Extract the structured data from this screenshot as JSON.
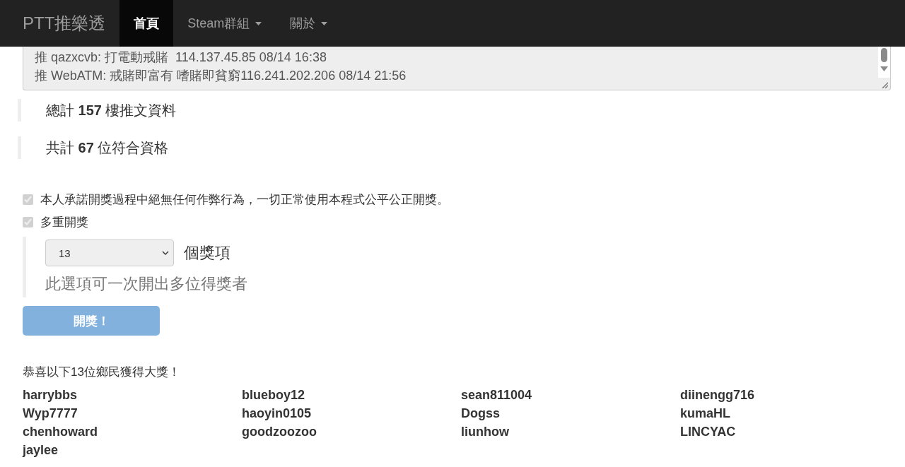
{
  "navbar": {
    "brand": "PTT推樂透",
    "items": [
      {
        "label": "首頁",
        "selected": true,
        "dropdown": false
      },
      {
        "label": "Steam群組",
        "selected": false,
        "dropdown": true
      },
      {
        "label": "關於",
        "selected": false,
        "dropdown": true
      }
    ]
  },
  "comments": [
    "推 qazxcvb: 打電動戒賭  114.137.45.85 08/14 16:38",
    "推 WebATM: 戒賭即富有 嗜賭即貧窮116.241.202.206 08/14 21:56"
  ],
  "stats": [
    "總計 **157** 樓推文資料",
    "共計 **67** 位符合資格"
  ],
  "options": [
    {
      "label": "本人承諾開獎過程中絕無任何作弊行為，一切正常使用本程式公平公正開獎。",
      "checked": true,
      "disabled": true
    },
    {
      "label": "多重開獎",
      "checked": true,
      "disabled": true
    }
  ],
  "prize_count": {
    "value": "13",
    "unit": "個獎項",
    "help": "此選項可一次開出多位得獎者"
  },
  "draw_button": {
    "label": "開獎！",
    "disabled": true
  },
  "result": {
    "title": "恭喜以下13位鄉民獲得大獎！",
    "winners": [
      "harrybbs",
      "blueboy12",
      "sean811004",
      "diinengg716",
      "Wyp7777",
      "haoyin0105",
      "Dogss",
      "kumaHL",
      "chenhoward",
      "goodzoozoo",
      "liunhow",
      "LINCYAC",
      "jaylee"
    ]
  }
}
